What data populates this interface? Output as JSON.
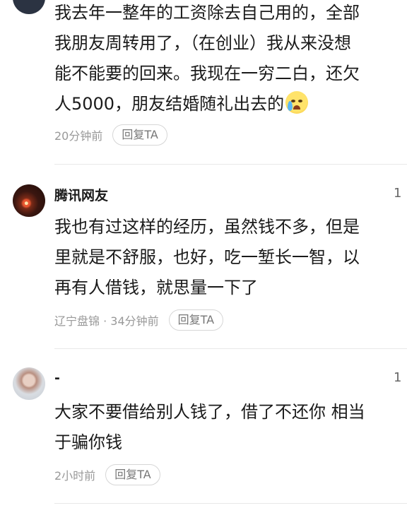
{
  "comments": [
    {
      "username": "",
      "lines": [
        "我去年一整年的工资除去自己用的，全部",
        "我朋友周转用了，（在创业）我从来没想",
        "能不能要的回来。我现在一穷二白，还欠",
        "人5000，朋友结婚随礼出去的"
      ],
      "emoji": "crying-face-emoji",
      "meta": "20分钟前",
      "reply_label": "回复TA"
    },
    {
      "username": "腾讯网友",
      "likes": "1",
      "lines": [
        "我也有过这样的经历，虽然钱不多，但是",
        "里就是不舒服，也好，吃一堑长一智，以",
        "再有人借钱，就思量一下了"
      ],
      "meta": "辽宁盘锦 · 34分钟前",
      "reply_label": "回复TA"
    },
    {
      "username": "-",
      "likes": "1",
      "lines": [
        "大家不要借给别人钱了，借了不还你 相当",
        "于骗你钱"
      ],
      "meta": "2小时前",
      "reply_label": "回复TA"
    }
  ]
}
